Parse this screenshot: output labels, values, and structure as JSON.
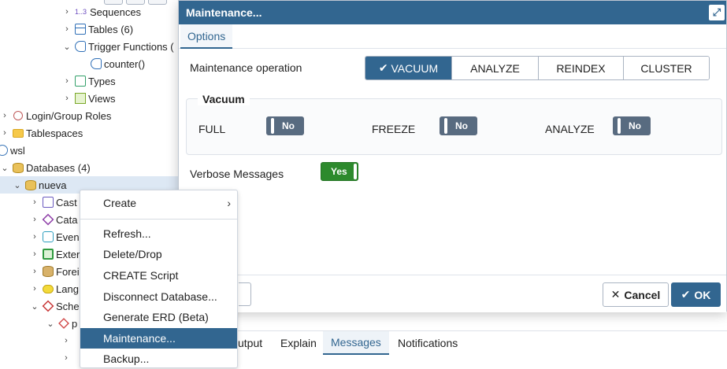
{
  "tree": {
    "sequences": "Sequences",
    "sequences_icon_text": "1..3",
    "tables": "Tables (6)",
    "trigger_functions": "Trigger Functions (",
    "counter": "counter()",
    "types": "Types",
    "views": "Views",
    "login_roles": "Login/Group Roles",
    "tablespaces": "Tablespaces",
    "server": "wsl",
    "databases": "Databases (4)",
    "nueva": "nueva",
    "casts": "Cast",
    "catalogs": "Cata",
    "event_triggers": "Even",
    "extensions": "Exter",
    "foreign": "Forei",
    "languages": "Lang",
    "schemas": "Sche",
    "public": "p"
  },
  "context_menu": {
    "create": "Create",
    "refresh": "Refresh...",
    "delete": "Delete/Drop",
    "create_script": "CREATE Script",
    "disconnect": "Disconnect Database...",
    "erd": "Generate ERD (Beta)",
    "maintenance": "Maintenance...",
    "backup": "Backup..."
  },
  "bottom_tabs": {
    "output": "utput",
    "explain": "Explain",
    "messages": "Messages",
    "notifications": "Notifications"
  },
  "dialog": {
    "title": "Maintenance...",
    "tab_options": "Options",
    "op_label": "Maintenance operation",
    "ops": {
      "vacuum": "VACUUM",
      "analyze": "ANALYZE",
      "reindex": "REINDEX",
      "cluster": "CLUSTER"
    },
    "vacuum_legend": "Vacuum",
    "full_label": "FULL",
    "full_value": "No",
    "freeze_label": "FREEZE",
    "freeze_value": "No",
    "analyze_label": "ANALYZE",
    "analyze_value": "No",
    "verbose_label": "Verbose Messages",
    "verbose_value": "Yes",
    "cancel": "Cancel",
    "ok": "OK"
  },
  "colors": {
    "primary": "#326690",
    "toggle_yes": "#2d8a2d",
    "toggle_no": "#586b80"
  }
}
